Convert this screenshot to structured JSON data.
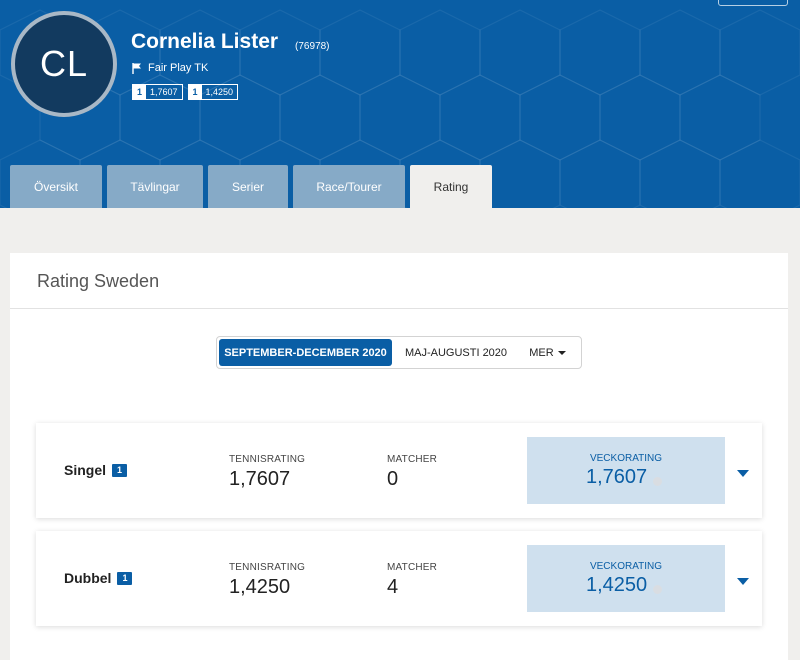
{
  "player": {
    "initials": "CL",
    "name": "Cornelia Lister",
    "id": "(76978)",
    "club": "Fair Play TK",
    "badges": [
      {
        "rank": "1",
        "value": "1,7607"
      },
      {
        "rank": "1",
        "value": "1,4250"
      }
    ]
  },
  "tabs": [
    {
      "label": "Översikt"
    },
    {
      "label": "Tävlingar"
    },
    {
      "label": "Serier"
    },
    {
      "label": "Race/Tourer"
    },
    {
      "label": "Rating",
      "active": true
    }
  ],
  "card": {
    "title": "Rating Sweden",
    "periods": {
      "active": "SEPTEMBER-DECEMBER 2020",
      "second": "MAJ-AUGUSTI 2020",
      "more": "MER"
    },
    "rows": [
      {
        "title": "Singel",
        "badge": "1",
        "tennisrating_label": "TENNISRATING",
        "tennisrating": "1,7607",
        "matcher_label": "MATCHER",
        "matcher": "0",
        "veckorating_label": "VECKORATING",
        "veckorating": "1,7607"
      },
      {
        "title": "Dubbel",
        "badge": "1",
        "tennisrating_label": "TENNISRATING",
        "tennisrating": "1,4250",
        "matcher_label": "MATCHER",
        "matcher": "4",
        "veckorating_label": "VECKORATING",
        "veckorating": "1,4250"
      }
    ]
  },
  "colors": {
    "brand": "#0a5ea5",
    "tab_inactive": "#86aac7",
    "weekly_bg": "#cfe0ee"
  }
}
